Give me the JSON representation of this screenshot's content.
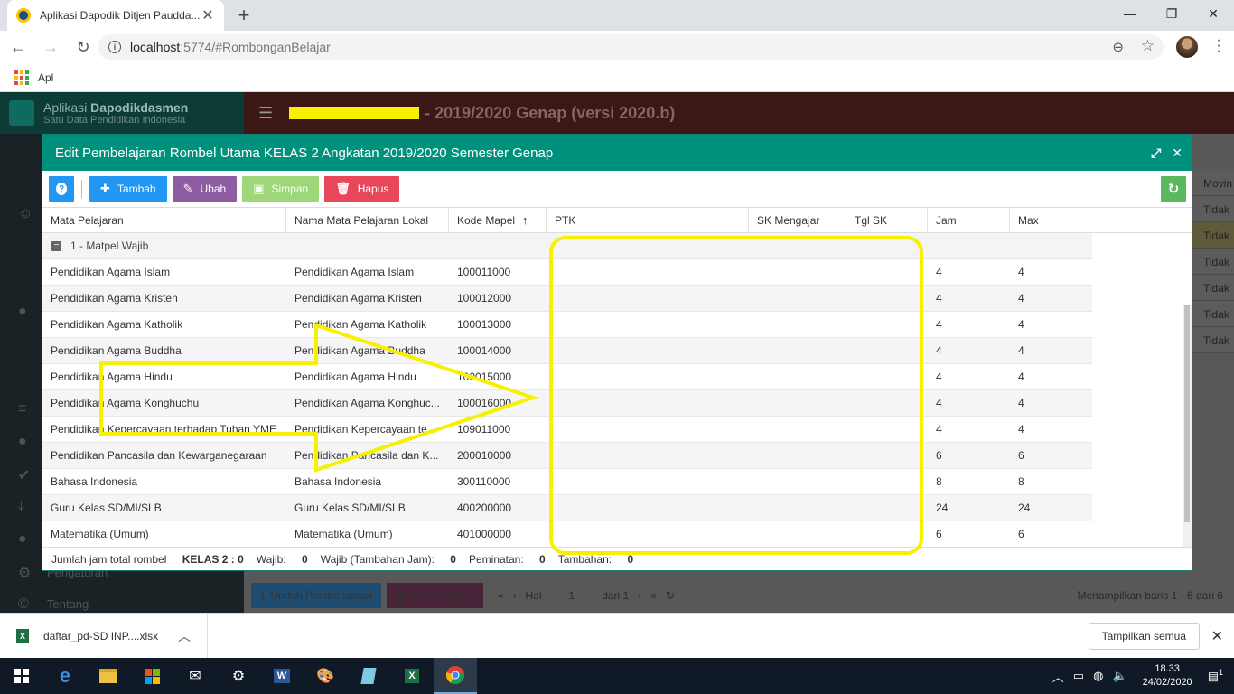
{
  "browser": {
    "tab_title": "Aplikasi Dapodik Ditjen Paudda...",
    "url_host": "localhost",
    "url_path": ":5774/#RombonganBelajar",
    "bookmark_apps": "Apl"
  },
  "app": {
    "brand_prefix": "Aplikasi ",
    "brand_name": "Dapodikdasmen",
    "brand_tagline": "Satu Data Pendidikan Indonesia",
    "header_title": "- 2019/2020 Genap (versi 2020.b)",
    "side_pengaturan": "Pengaturan",
    "side_tentang": "Tentang",
    "right_col_header": "Movin",
    "right_col_values": [
      "Tidak",
      "Tidak",
      "Tidak",
      "Tidak",
      "Tidak",
      "Tidak"
    ],
    "footer": {
      "unduh": "Unduh Pembelajaran",
      "menu_aksi": "Menu Aksi",
      "hal": "Hal",
      "page": "1",
      "of": "dari 1",
      "showing": "Menampilkan baris 1 - 6 dari 6"
    }
  },
  "modal": {
    "title": "Edit Pembelajaran Rombel Utama KELAS 2 Angkatan 2019/2020 Semester Genap",
    "buttons": {
      "tambah": "Tambah",
      "ubah": "Ubah",
      "simpan": "Simpan",
      "hapus": "Hapus"
    },
    "columns": [
      "Mata Pelajaran",
      "Nama Mata Pelajaran Lokal",
      "Kode Mapel",
      "PTK",
      "SK Mengajar",
      "Tgl SK",
      "Jam",
      "Max"
    ],
    "sort_indicator": "↑",
    "group_label": "1 - Matpel Wajib",
    "rows": [
      {
        "mapel": "Pendidikan Agama Islam",
        "lokal": "Pendidikan Agama Islam",
        "kode": "100011000",
        "jam": "4",
        "max": "4"
      },
      {
        "mapel": "Pendidikan Agama Kristen",
        "lokal": "Pendidikan Agama Kristen",
        "kode": "100012000",
        "jam": "4",
        "max": "4"
      },
      {
        "mapel": "Pendidikan Agama Katholik",
        "lokal": "Pendidikan Agama Katholik",
        "kode": "100013000",
        "jam": "4",
        "max": "4"
      },
      {
        "mapel": "Pendidikan Agama Buddha",
        "lokal": "Pendidikan Agama Buddha",
        "kode": "100014000",
        "jam": "4",
        "max": "4"
      },
      {
        "mapel": "Pendidikan Agama Hindu",
        "lokal": "Pendidikan Agama Hindu",
        "kode": "100015000",
        "jam": "4",
        "max": "4"
      },
      {
        "mapel": "Pendidikan Agama Konghuchu",
        "lokal": "Pendidikan Agama Konghuc...",
        "kode": "100016000",
        "jam": "4",
        "max": "4"
      },
      {
        "mapel": "Pendidikan Kepercayaan terhadap Tuhan YME",
        "lokal": "Pendidikan Kepercayaan te...",
        "kode": "109011000",
        "jam": "4",
        "max": "4"
      },
      {
        "mapel": "Pendidikan Pancasila dan Kewarganegaraan",
        "lokal": "Pendidikan Pancasila dan K...",
        "kode": "200010000",
        "jam": "6",
        "max": "6"
      },
      {
        "mapel": "Bahasa Indonesia",
        "lokal": "Bahasa Indonesia",
        "kode": "300110000",
        "jam": "8",
        "max": "8"
      },
      {
        "mapel": "Guru Kelas SD/MI/SLB",
        "lokal": "Guru Kelas SD/MI/SLB",
        "kode": "400200000",
        "jam": "24",
        "max": "24"
      },
      {
        "mapel": "Matematika (Umum)",
        "lokal": "Matematika (Umum)",
        "kode": "401000000",
        "jam": "6",
        "max": "6"
      }
    ],
    "summary": {
      "total_label": "Jumlah jam total rombel",
      "total_kelas": "KELAS 2 : 0",
      "wajib_label": "Wajib:",
      "wajib": "0",
      "wajib_tambahan_label": "Wajib (Tambahan Jam):",
      "wajib_tambahan": "0",
      "peminatan_label": "Peminatan:",
      "peminatan": "0",
      "tambahan_label": "Tambahan:",
      "tambahan": "0"
    }
  },
  "download": {
    "file_name": "daftar_pd-SD INP....xlsx",
    "show_all": "Tampilkan semua"
  },
  "taskbar": {
    "time": "18.33",
    "date": "24/02/2020",
    "notif_count": "1"
  },
  "colors": {
    "modal_header": "#00917c",
    "annotation": "#f7f000"
  }
}
